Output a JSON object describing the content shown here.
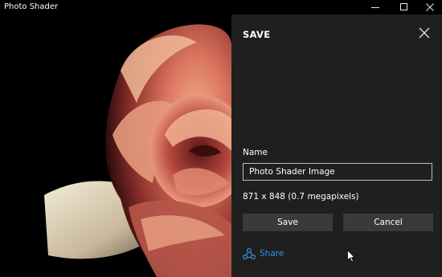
{
  "window": {
    "title": "Photo Shader"
  },
  "save_pane": {
    "title": "SAVE",
    "name_label": "Name",
    "name_value": "Photo Shader Image",
    "dimensions": "871 x 848 (0.7 megapixels)",
    "save_label": "Save",
    "cancel_label": "Cancel",
    "share_label": "Share"
  },
  "colors": {
    "pane_background": "#1f1f1f",
    "button_background": "#3a3a3a",
    "accent_link": "#3b8ee0",
    "window_background": "#000000"
  },
  "icons": {
    "minimize": "minimize-icon",
    "maximize": "maximize-icon",
    "close": "close-icon",
    "pane_close": "close-icon",
    "share": "share-icon"
  }
}
